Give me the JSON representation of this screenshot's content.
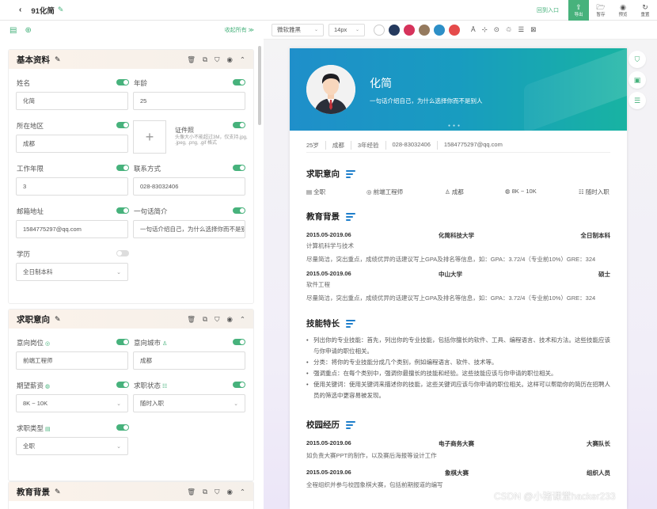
{
  "topbar": {
    "title": "91化简",
    "back": "‹",
    "link": "回到入口",
    "buttons": [
      {
        "icon": "⇪",
        "label": "导出"
      },
      {
        "icon": "🗁",
        "label": "暂存"
      },
      {
        "icon": "◉",
        "label": "预览"
      },
      {
        "icon": "↻",
        "label": "重置"
      }
    ]
  },
  "left": {
    "collapse": "收起所有 ≫",
    "basic": {
      "title": "基本资料",
      "name_label": "姓名",
      "name_value": "化简",
      "age_label": "年龄",
      "age_value": "25",
      "region_label": "所在地区",
      "region_value": "成都",
      "photo_label": "证件照",
      "photo_hint": "头像大小不能超过3M，仅支持.jpg, .jpeg, .png, .gif 格式",
      "years_label": "工作年限",
      "years_value": "3",
      "phone_label": "联系方式",
      "phone_value": "028-83032406",
      "email_label": "邮箱地址",
      "email_value": "1584775297@qq.com",
      "intro_label": "一句话简介",
      "intro_value": "一句话介绍自己，为什么选择你而不是别",
      "edu_label": "学历",
      "edu_value": "全日制本科"
    },
    "intent": {
      "title": "求职意向",
      "pos_label": "意向岗位",
      "pos_value": "前端工程师",
      "city_label": "意向城市",
      "city_value": "成都",
      "salary_label": "期望薪资",
      "salary_value": "8K ~ 10K",
      "status_label": "求职状态",
      "status_value": "随时入职",
      "type_label": "求职类型",
      "type_value": "全职"
    },
    "education": {
      "title": "教育背景"
    }
  },
  "toolbar": {
    "font": "微软雅黑",
    "size": "14px",
    "colors": [
      "#ffffff",
      "#253a5e",
      "#d6335b",
      "#957a5e",
      "#2d8fc7",
      "#e54b4b"
    ],
    "icons": [
      "Ā",
      "⊹",
      "⊙",
      "♲",
      "☰",
      "⊠"
    ]
  },
  "resume": {
    "name": "化简",
    "motto": "一句话介绍自己，为什么选择你而不是别人",
    "info": [
      "25岁",
      "成都",
      "3年经验",
      "028-83032406",
      "1584775297@qq.com"
    ],
    "intent_title": "求职意向",
    "intent_items": [
      "全职",
      "前端工程师",
      "成都",
      "8K ~ 10K",
      "随时入职"
    ],
    "edu_title": "教育背景",
    "edu": [
      {
        "date": "2015.05-2019.06",
        "school": "化简科技大学",
        "degree": "全日制本科",
        "major": "计算机科学与技术",
        "desc": "尽量简洁，突出重点，成绩优异的话建议写上GPA及排名等信息，如：GPA：3.72/4（专业前10%）GRE：324"
      },
      {
        "date": "2015.05-2019.06",
        "school": "中山大学",
        "degree": "硕士",
        "major": "软件工程",
        "desc": "尽量简洁，突出重点，成绩优异的话建议写上GPA及排名等信息，如：GPA：3.72/4（专业前10%）GRE：324"
      }
    ],
    "skill_title": "技能特长",
    "skills": [
      "列出你的专业技能：首先，列出你的专业技能，包括你擅长的软件、工具、编程语言、技术和方法。这些技能应该与你申请的职位相关。",
      "分类：将你的专业技能分成几个类别，例如编程语言、软件、技术等。",
      "强调重点：在每个类别中，强调你最擅长的技能和经验。这些技能应该与你申请的职位相关。",
      "使用关键词：使用关键词来描述你的技能，这些关键词应该与你申请的职位相关。这样可以帮助你的简历在招聘人员的筛选中更容易被发现。"
    ],
    "campus_title": "校园经历",
    "campus": [
      {
        "date": "2015.05-2019.06",
        "name": "电子商务大赛",
        "role": "大赛队长",
        "desc": "如负责大赛PPT的制作，以及赛后海报等设计工作"
      },
      {
        "date": "2015.05-2019.06",
        "name": "象棋大赛",
        "role": "组织人员",
        "desc": "全程组织并参与校园象棋大赛，包括前期报道的编写"
      }
    ]
  },
  "watermark": "CSDN @小猪课堂hacker233"
}
